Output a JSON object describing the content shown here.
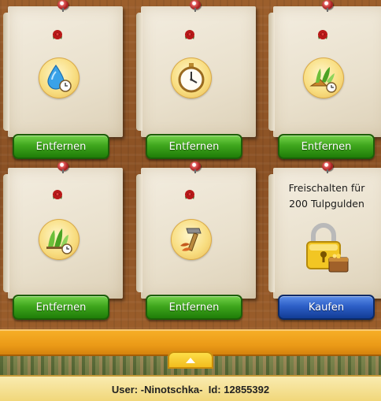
{
  "slots": [
    {
      "icon": "water-clock-icon",
      "button": "Entfernen"
    },
    {
      "icon": "stopwatch-icon",
      "button": "Entfernen"
    },
    {
      "icon": "fertilizer-clock-icon",
      "button": "Entfernen"
    },
    {
      "icon": "plants-clock-icon",
      "button": "Entfernen"
    },
    {
      "icon": "hammer-tools-icon",
      "button": "Entfernen"
    }
  ],
  "locked_slot": {
    "text_line1": "Freischalten für",
    "text_line2": "200 Tulpgulden",
    "icon": "padlock-treasure-icon",
    "button": "Kaufen"
  },
  "status": {
    "user_label": "User:",
    "user_name": "-Ninotschka-",
    "id_label": "Id:",
    "id_value": "12855392"
  },
  "colors": {
    "green_button": "#3fa61d",
    "blue_button": "#2d5fc7",
    "board_wood": "#8b5124",
    "shelf": "#eb9a17"
  }
}
